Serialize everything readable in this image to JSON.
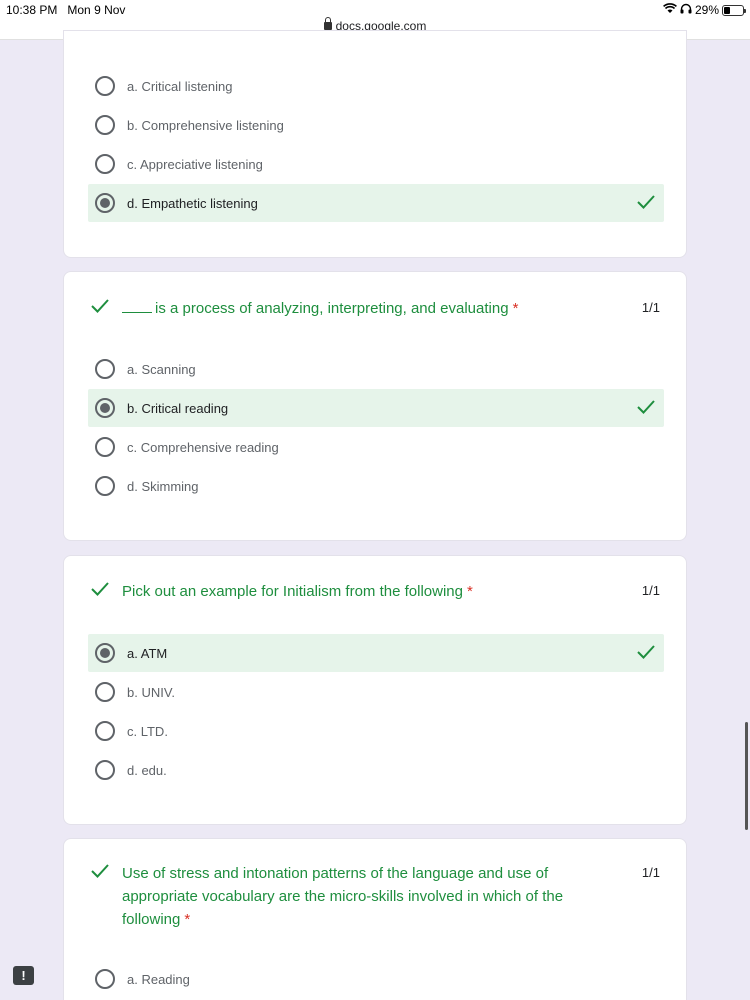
{
  "status_bar": {
    "time": "10:38 PM",
    "date": "Mon 9 Nov",
    "battery": "29%",
    "url": "docs.google.com"
  },
  "colors": {
    "correct_green": "#1e8e3e",
    "correct_bg": "#e6f4ea",
    "required_red": "#d93025"
  },
  "questions": [
    {
      "title": "",
      "options": [
        {
          "label": "a. Critical listening",
          "selected": false
        },
        {
          "label": "b. Comprehensive listening",
          "selected": false
        },
        {
          "label": "c. Appreciative listening",
          "selected": false
        },
        {
          "label": "d. Empathetic listening",
          "selected": true
        }
      ]
    },
    {
      "title": "is a process of analyzing, interpreting, and evaluating",
      "required": "*",
      "score": "1/1",
      "options": [
        {
          "label": "a. Scanning",
          "selected": false
        },
        {
          "label": "b. Critical reading",
          "selected": true
        },
        {
          "label": "c. Comprehensive reading",
          "selected": false
        },
        {
          "label": "d. Skimming",
          "selected": false
        }
      ]
    },
    {
      "title": "Pick out an example for Initialism from the following",
      "required": "*",
      "score": "1/1",
      "options": [
        {
          "label": "a. ATM",
          "selected": true
        },
        {
          "label": "b. UNIV.",
          "selected": false
        },
        {
          "label": "c. LTD.",
          "selected": false
        },
        {
          "label": "d. edu.",
          "selected": false
        }
      ]
    },
    {
      "title": "Use of stress and intonation patterns of the language and use of appropriate vocabulary are the micro-skills involved in which of the following",
      "required": "*",
      "score": "1/1",
      "options": [
        {
          "label": "a. Reading",
          "selected": false
        }
      ]
    }
  ],
  "feedback_button": "!"
}
